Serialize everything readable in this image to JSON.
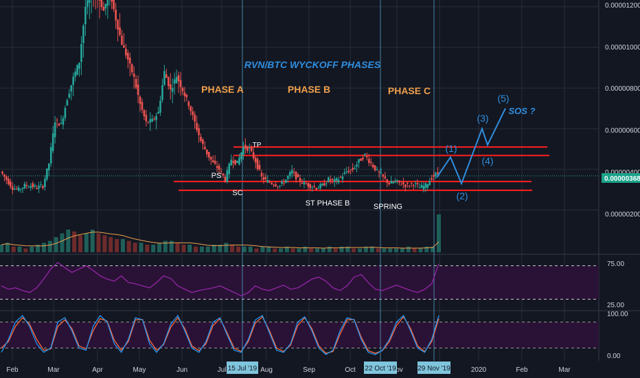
{
  "chart_data": {
    "type": "candlestick",
    "title": "RVN/BTC WYCKOFF PHASES",
    "price_axis": {
      "ticks": [
        "0.00001200",
        "0.00001000",
        "0.00000800",
        "0.00000600",
        "0.00000400",
        "0.00000200"
      ],
      "values": [
        12,
        10,
        8,
        6,
        4,
        2
      ],
      "unit_scale": "1e-6",
      "current_price_label": "0.00000368",
      "current_price": 3.68,
      "range": [
        0,
        12.2
      ]
    },
    "time_axis": {
      "labels": [
        "Feb",
        "Mar",
        "Apr",
        "May",
        "Jun",
        "Jul",
        "Aug",
        "Sep",
        "Oct",
        "Nov",
        "2020",
        "Feb",
        "Mar"
      ],
      "highlight_dates": [
        "15 Jul '19",
        "22 Oct '19",
        "29 Nov '19"
      ]
    },
    "price_series": [
      {
        "t": 0,
        "v": 3.9
      },
      {
        "t": 1,
        "v": 3.5
      },
      {
        "t": 2,
        "v": 3.1
      },
      {
        "t": 3,
        "v": 3.0
      },
      {
        "t": 4,
        "v": 3.2
      },
      {
        "t": 5,
        "v": 3.2
      },
      {
        "t": 6,
        "v": 3.1
      },
      {
        "t": 7,
        "v": 3.2
      },
      {
        "t": 8,
        "v": 4.3
      },
      {
        "t": 9,
        "v": 6.4
      },
      {
        "t": 10,
        "v": 6.2
      },
      {
        "t": 11,
        "v": 7.5
      },
      {
        "t": 12,
        "v": 8.5
      },
      {
        "t": 13,
        "v": 9.3
      },
      {
        "t": 14,
        "v": 12.0
      },
      {
        "t": 15,
        "v": 12.6
      },
      {
        "t": 16,
        "v": 12.6
      },
      {
        "t": 17,
        "v": 11.8
      },
      {
        "t": 18,
        "v": 12.8
      },
      {
        "t": 19,
        "v": 11.4
      },
      {
        "t": 20,
        "v": 10.2
      },
      {
        "t": 21,
        "v": 9.4
      },
      {
        "t": 22,
        "v": 8.5
      },
      {
        "t": 23,
        "v": 7.2
      },
      {
        "t": 24,
        "v": 6.3
      },
      {
        "t": 25,
        "v": 6.4
      },
      {
        "t": 26,
        "v": 6.8
      },
      {
        "t": 27,
        "v": 8.8
      },
      {
        "t": 28,
        "v": 7.9
      },
      {
        "t": 29,
        "v": 8.6
      },
      {
        "t": 30,
        "v": 7.9
      },
      {
        "t": 31,
        "v": 7.2
      },
      {
        "t": 32,
        "v": 6.3
      },
      {
        "t": 33,
        "v": 5.4
      },
      {
        "t": 34,
        "v": 4.8
      },
      {
        "t": 35,
        "v": 4.3
      },
      {
        "t": 36,
        "v": 4.0
      },
      {
        "t": 37,
        "v": 3.5
      },
      {
        "t": 38,
        "v": 4.5
      },
      {
        "t": 39,
        "v": 4.3
      },
      {
        "t": 40,
        "v": 5.1
      },
      {
        "t": 41,
        "v": 5.0
      },
      {
        "t": 42,
        "v": 4.4
      },
      {
        "t": 43,
        "v": 3.6
      },
      {
        "t": 44,
        "v": 3.4
      },
      {
        "t": 45,
        "v": 3.3
      },
      {
        "t": 46,
        "v": 3.2
      },
      {
        "t": 47,
        "v": 3.5
      },
      {
        "t": 48,
        "v": 3.9
      },
      {
        "t": 49,
        "v": 3.5
      },
      {
        "t": 50,
        "v": 3.3
      },
      {
        "t": 51,
        "v": 3.2
      },
      {
        "t": 52,
        "v": 3.1
      },
      {
        "t": 53,
        "v": 3.2
      },
      {
        "t": 54,
        "v": 3.5
      },
      {
        "t": 55,
        "v": 3.4
      },
      {
        "t": 56,
        "v": 3.6
      },
      {
        "t": 57,
        "v": 3.9
      },
      {
        "t": 58,
        "v": 4.0
      },
      {
        "t": 59,
        "v": 4.4
      },
      {
        "t": 60,
        "v": 4.7
      },
      {
        "t": 61,
        "v": 4.3
      },
      {
        "t": 62,
        "v": 3.9
      },
      {
        "t": 63,
        "v": 3.6
      },
      {
        "t": 64,
        "v": 3.3
      },
      {
        "t": 65,
        "v": 3.4
      },
      {
        "t": 66,
        "v": 3.3
      },
      {
        "t": 67,
        "v": 3.2
      },
      {
        "t": 68,
        "v": 3.3
      },
      {
        "t": 69,
        "v": 3.1
      },
      {
        "t": 70,
        "v": 3.2
      },
      {
        "t": 71,
        "v": 3.6
      },
      {
        "t": 72,
        "v": 3.8
      }
    ],
    "horizontal_levels": [
      {
        "name": "upper_resistance",
        "value": 5.1
      },
      {
        "name": "lower_resistance",
        "value": 4.68
      },
      {
        "name": "upper_support",
        "value": 3.4
      },
      {
        "name": "lower_support",
        "value": 2.97
      }
    ],
    "phase_labels": [
      "PHASE A",
      "PHASE B",
      "PHASE C"
    ],
    "event_labels": [
      "PS",
      "SC",
      "TP",
      "ST PHASE B",
      "SPRING"
    ],
    "projection": {
      "wave_labels": [
        "(1)",
        "(2)",
        "(3)",
        "(4)",
        "(5)"
      ],
      "points": [
        {
          "v": 3.6
        },
        {
          "v": 4.6
        },
        {
          "v": 3.3
        },
        {
          "v": 6.0
        },
        {
          "v": 5.2
        },
        {
          "v": 7.0
        }
      ],
      "label": "SOS ?"
    },
    "rsi": {
      "ticks": [
        "75.00",
        "25.00"
      ],
      "values": [
        75,
        25
      ],
      "range": [
        10,
        90
      ],
      "series": [
        45,
        40,
        42,
        38,
        35,
        42,
        55,
        70,
        80,
        72,
        65,
        70,
        75,
        68,
        60,
        55,
        52,
        60,
        50,
        48,
        45,
        42,
        50,
        60,
        56,
        45,
        40,
        35,
        38,
        40,
        42,
        45,
        40,
        35,
        30,
        35,
        45,
        40,
        38,
        42,
        46,
        40,
        42,
        48,
        55,
        58,
        52,
        42,
        38,
        45,
        58,
        62,
        50,
        40,
        38,
        42,
        46,
        42,
        38,
        35,
        40,
        48,
        78
      ]
    },
    "stoch": {
      "ticks": [
        "100.00",
        "0.00"
      ],
      "values": [
        100,
        0
      ],
      "range": [
        0,
        100
      ],
      "k": [
        10,
        40,
        80,
        95,
        70,
        30,
        10,
        20,
        80,
        90,
        60,
        20,
        15,
        70,
        95,
        80,
        30,
        10,
        40,
        90,
        85,
        30,
        10,
        30,
        75,
        95,
        60,
        20,
        10,
        35,
        80,
        90,
        50,
        15,
        10,
        40,
        85,
        95,
        55,
        15,
        10,
        30,
        80,
        92,
        60,
        20,
        5,
        15,
        60,
        90,
        85,
        40,
        10,
        5,
        15,
        40,
        80,
        95,
        60,
        20,
        10,
        40,
        95
      ],
      "d": [
        20,
        35,
        70,
        90,
        75,
        40,
        15,
        18,
        70,
        85,
        65,
        25,
        18,
        60,
        88,
        82,
        38,
        15,
        35,
        85,
        86,
        38,
        15,
        28,
        68,
        90,
        65,
        25,
        14,
        30,
        72,
        88,
        55,
        20,
        12,
        35,
        78,
        92,
        60,
        20,
        12,
        27,
        72,
        90,
        65,
        25,
        8,
        12,
        52,
        85,
        86,
        45,
        14,
        8,
        14,
        35,
        72,
        92,
        65,
        25,
        12,
        35,
        88
      ]
    },
    "volume": {
      "series": [
        4,
        5,
        3,
        3,
        2,
        3,
        4,
        5,
        6,
        8,
        10,
        12,
        11,
        9,
        10,
        12,
        10,
        9,
        8,
        7,
        7,
        6,
        5,
        5,
        4,
        4,
        5,
        6,
        6,
        5,
        4,
        4,
        3,
        3,
        3,
        4,
        4,
        5,
        4,
        3,
        3,
        3,
        2,
        3,
        3,
        2,
        2,
        3,
        2,
        2,
        3,
        2,
        2,
        2,
        3,
        2,
        3,
        3,
        2,
        2,
        3,
        3,
        2,
        2,
        2,
        2,
        2,
        3,
        2,
        2,
        3,
        3,
        20
      ]
    }
  },
  "colors": {
    "background": "#131722",
    "grid": "#2a2e39",
    "up": "#26a69a",
    "down": "#ef5350",
    "level": "#ff1f1f",
    "vline": "#4fa3c8",
    "projection": "#2f8fe0",
    "phase_text": "#f0a04b",
    "title_text": "#2f8fe0",
    "rsi_line": "#9c27b0",
    "rsi_band": "#2a1236",
    "stoch_k": "#2196f3",
    "stoch_d": "#ff6a3d",
    "volume_ma": "#f0a04b",
    "price_label_bg": "#1aa38a",
    "date_label_bg": "#7fc5dc"
  }
}
